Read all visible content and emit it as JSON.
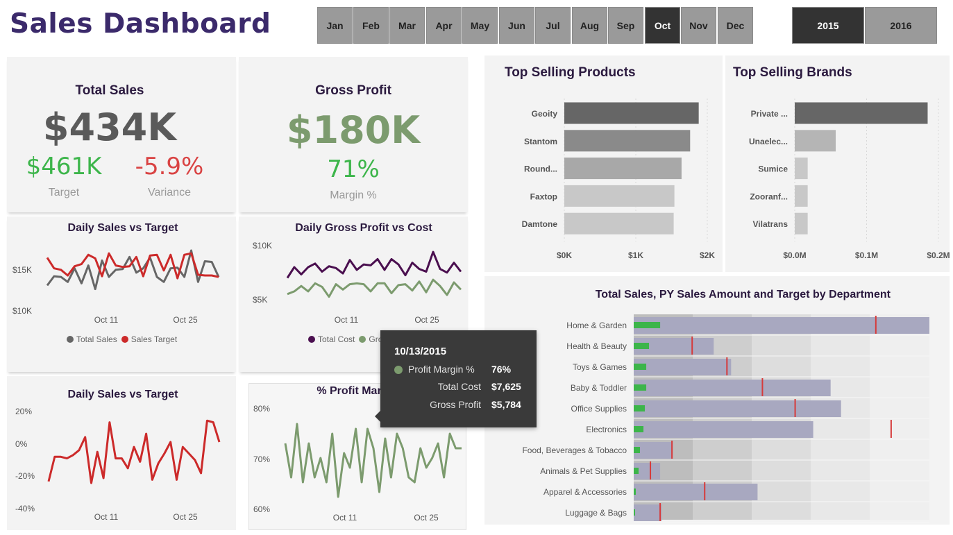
{
  "header": {
    "title": "Sales Dashboard",
    "months": [
      "Jan",
      "Feb",
      "Mar",
      "Apr",
      "May",
      "Jun",
      "Jul",
      "Aug",
      "Sep",
      "Oct",
      "Nov",
      "Dec"
    ],
    "selected_month": "Oct",
    "years": [
      "2015",
      "2016"
    ],
    "selected_year": "2015"
  },
  "kpi": {
    "total_sales": {
      "title": "Total Sales",
      "value": "$434K",
      "target_value": "$461K",
      "target_label": "Target",
      "variance_value": "-5.9%",
      "variance_label": "Variance"
    },
    "gross_profit": {
      "title": "Gross Profit",
      "value": "$180K",
      "margin_value": "71%",
      "margin_label": "Margin %"
    }
  },
  "colors": {
    "purple_title": "#3b2a6b",
    "green": "#3cb54a",
    "red": "#d94343",
    "gray_value": "#5a5a5a",
    "olive": "#7c9b6e",
    "dark_purple": "#4a0f4f",
    "sales_red": "#cc2a2a"
  },
  "chart_data": [
    {
      "id": "daily_sales_vs_target",
      "type": "line",
      "title": "Daily Sales vs Target",
      "x_ticks": [
        "Oct 11",
        "Oct 25"
      ],
      "y_ticks": [
        "$15K",
        "$10K"
      ],
      "ylim": [
        10,
        17
      ],
      "series": [
        {
          "name": "Total Sales",
          "color": "#666666",
          "values": [
            12.0,
            13.3,
            13.2,
            12.5,
            14.4,
            12.3,
            14.8,
            11.5,
            15.5,
            13.2,
            14.2,
            14.3,
            16.0,
            13.8,
            14.4,
            15.9,
            13.2,
            12.5,
            14.4,
            14.5,
            13.2,
            16.9,
            12.5,
            15.4,
            15.3,
            13.2
          ]
        },
        {
          "name": "Sales Target",
          "color": "#cc2a2a",
          "values": [
            15.9,
            14.4,
            14.2,
            13.4,
            14.7,
            15.0,
            16.3,
            15.8,
            13.3,
            16.5,
            14.8,
            14.6,
            14.7,
            16.0,
            13.3,
            16.2,
            16.3,
            14.1,
            16.3,
            13.0,
            16.3,
            16.5,
            13.5,
            13.4,
            13.4,
            13.2
          ]
        }
      ]
    },
    {
      "id": "daily_gross_profit_vs_cost",
      "type": "line",
      "title": "Daily Gross Profit vs Cost",
      "x_ticks": [
        "Oct 11",
        "Oct 25"
      ],
      "y_ticks": [
        "$10K",
        "$5K"
      ],
      "ylim": [
        4,
        10.5
      ],
      "series": [
        {
          "name": "Total Cost",
          "color": "#4a0f4f",
          "values": [
            6.9,
            8.1,
            7.3,
            8.1,
            8.5,
            7.6,
            8.2,
            8.0,
            7.4,
            8.9,
            7.8,
            8.4,
            8.3,
            9.0,
            7.8,
            9.0,
            8.4,
            7.2,
            8.6,
            7.9,
            7.6,
            9.8,
            7.9,
            7.5,
            8.6,
            7.6
          ]
        },
        {
          "name": "Gross Profit",
          "color": "#7c9b6e",
          "values": [
            5.1,
            5.4,
            6.0,
            5.4,
            6.3,
            5.9,
            4.8,
            6.2,
            5.6,
            6.2,
            6.3,
            6.2,
            5.4,
            6.3,
            6.3,
            5.2,
            6.1,
            6.2,
            5.5,
            6.5,
            5.3,
            6.7,
            6.0,
            5.0,
            6.4,
            5.6
          ]
        }
      ]
    },
    {
      "id": "daily_sales_vs_target_pct",
      "type": "line",
      "title": "Daily Sales vs Target",
      "x_ticks": [
        "Oct 11",
        "Oct 25"
      ],
      "y_ticks": [
        "20%",
        "0%",
        "-20%",
        "-40%"
      ],
      "ylim": [
        -40,
        20
      ],
      "series": [
        {
          "name": "Variance",
          "color": "#cc2a2a",
          "values": [
            -23,
            -8,
            -8,
            -9,
            -7,
            -4,
            4,
            -24,
            -5,
            -21,
            13,
            -9,
            -9,
            -15,
            -2,
            -11,
            6,
            -22,
            -12,
            -6,
            1,
            -22,
            -2,
            -6,
            -10,
            -18,
            14,
            13,
            1
          ]
        }
      ]
    },
    {
      "id": "profit_margin",
      "type": "line",
      "title": "% Profit Margin",
      "x_ticks": [
        "Oct 11",
        "Oct 25"
      ],
      "y_ticks": [
        "80%",
        "70%",
        "60%"
      ],
      "ylim": [
        60,
        82
      ],
      "series": [
        {
          "name": "Profit Margin",
          "color": "#7c9b6e",
          "values": [
            74,
            67,
            78,
            66,
            74,
            67,
            71,
            66,
            76,
            63,
            72,
            69,
            77,
            66,
            77,
            73,
            64,
            75,
            67,
            76,
            73,
            67,
            66,
            73,
            69,
            71,
            74,
            67,
            76,
            73,
            73
          ]
        }
      ]
    },
    {
      "id": "top_selling_products",
      "type": "bar",
      "title": "Top Selling Products",
      "categories": [
        "Geoity",
        "Stantom",
        "Round...",
        "Faxtop",
        "Damtone"
      ],
      "values": [
        1.88,
        1.76,
        1.64,
        1.54,
        1.53
      ],
      "x_ticks": [
        "$0K",
        "$1K",
        "$2K"
      ],
      "xlim": [
        0,
        2
      ],
      "colors": [
        "#666666",
        "#8a8a8a",
        "#a8a8a8",
        "#c8c8c8",
        "#c8c8c8"
      ]
    },
    {
      "id": "top_selling_brands",
      "type": "bar",
      "title": "Top Selling Brands",
      "categories": [
        "Private ...",
        "Unaelec...",
        "Sumice",
        "Zooranf...",
        "Vilatrans"
      ],
      "values": [
        0.185,
        0.057,
        0.018,
        0.018,
        0.018
      ],
      "x_ticks": [
        "$0.0M",
        "$0.1M",
        "$0.2M"
      ],
      "xlim": [
        0,
        0.2
      ],
      "colors": [
        "#666666",
        "#b5b5b5",
        "#c8c8c8",
        "#c8c8c8",
        "#c8c8c8"
      ]
    },
    {
      "id": "dept_bullet",
      "type": "bar",
      "title": "Total Sales, PY Sales Amount and Target by Department",
      "categories": [
        "Home & Garden",
        "Health & Beauty",
        "Toys & Games",
        "Baby & Toddler",
        "Office Supplies",
        "Electronics",
        "Food, Beverages & Tobacco",
        "Animals & Pet Supplies",
        "Apparel & Accessories",
        "Luggage & Bags"
      ],
      "series": [
        {
          "name": "Total Sales",
          "color": "#3cb54a",
          "values": [
            38,
            22,
            18,
            18,
            16,
            14,
            9,
            7,
            3,
            2
          ]
        },
        {
          "name": "PY Sales Amount",
          "color": "#a8a8c0",
          "values": [
            425,
            115,
            140,
            283,
            298,
            258,
            55,
            38,
            178,
            40
          ]
        },
        {
          "name": "Target",
          "color": "#d63a3a",
          "values": [
            348,
            84,
            134,
            185,
            232,
            370,
            55,
            24,
            102,
            38
          ]
        }
      ]
    }
  ],
  "tooltip": {
    "date": "10/13/2015",
    "rows": [
      {
        "label": "Profit Margin %",
        "value": "76%"
      },
      {
        "label": "Total Cost",
        "value": "$7,625"
      },
      {
        "label": "Gross Profit",
        "value": "$5,784"
      }
    ]
  }
}
